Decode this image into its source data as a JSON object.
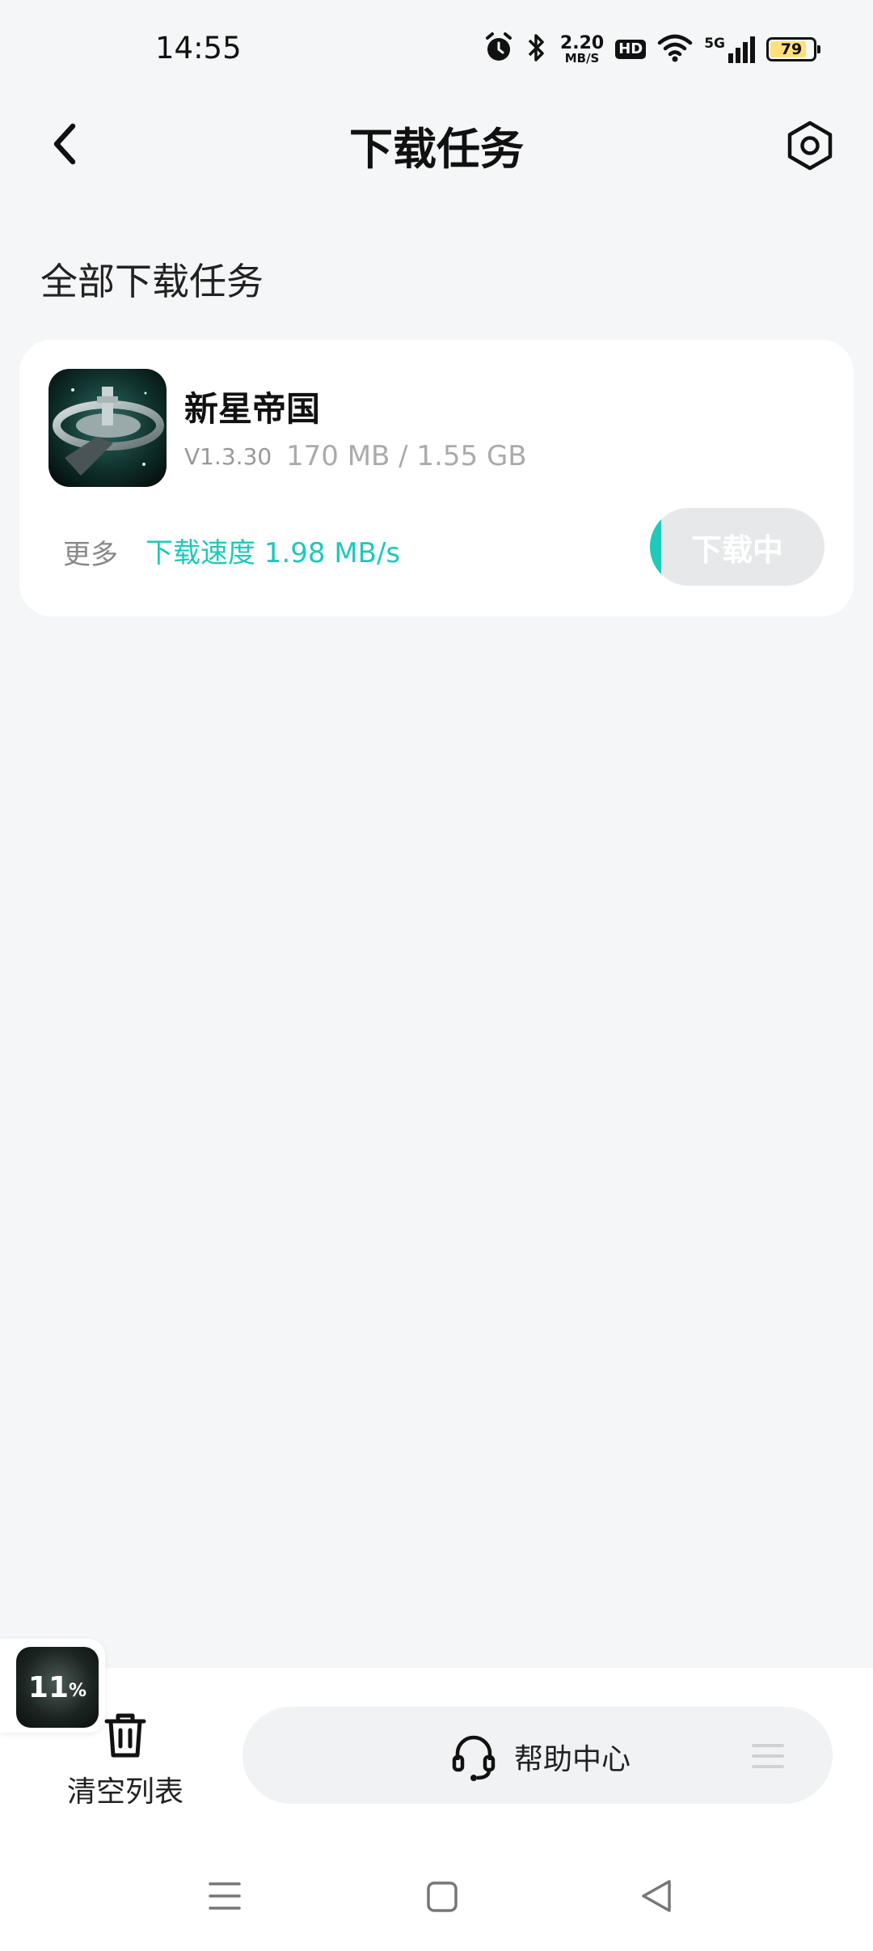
{
  "status_bar": {
    "time": "14:55",
    "net_speed_value": "2.20",
    "net_speed_unit": "MB/S",
    "hd_label": "HD",
    "network_label": "5G",
    "battery": "79",
    "icons": [
      "alarm-icon",
      "bluetooth-icon",
      "wifi-icon",
      "signal-icon",
      "battery-icon"
    ]
  },
  "header": {
    "title": "下载任务",
    "back_icon": "chevron-left-icon",
    "settings_icon": "hexagon-gear-icon"
  },
  "section_title": "全部下载任务",
  "task": {
    "name": "新星帝国",
    "version": "V1.3.30",
    "size": "170 MB / 1.55 GB",
    "more_label": "更多",
    "speed": "下载速度 1.98 MB/s",
    "button_label": "下载中",
    "progress": 0.11
  },
  "floating": {
    "percent": "11",
    "percent_sign": "%"
  },
  "bottom": {
    "clear_label": "清空列表",
    "help_label": "帮助中心"
  },
  "colors": {
    "accent": "#1ecab9",
    "background": "#f5f6f8"
  }
}
